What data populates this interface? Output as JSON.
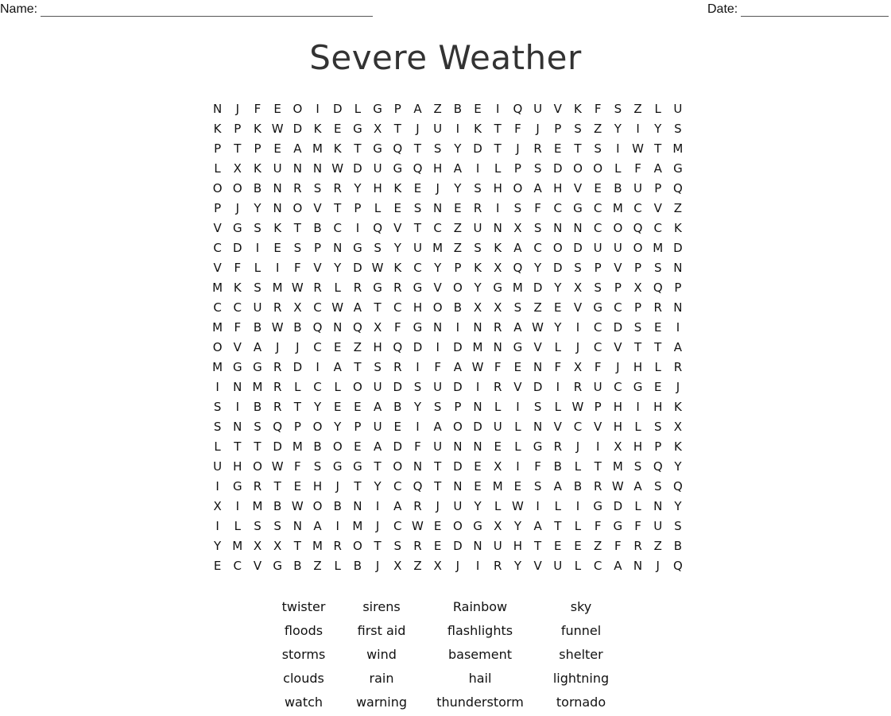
{
  "header": {
    "name_label": "Name:",
    "date_label": "Date:"
  },
  "title": "Severe Weather",
  "grid": [
    "NJFEOIDLGPAZBEIQUVKFSZLU",
    "KPKWDKEGXTJUIKTFJPSZYIYS",
    "PTPEAMKTGQTSYDTJRETSIWTM",
    "LXKUNNWDUGQHAILPSDOOLFAG",
    "OOBNRSRYHKEJYSHOAHVEBUPQ",
    "PJYNOVTPLESNERISFCGCMCVZ",
    "VGSKTBCIQVTCZUNXSNNCOQCK",
    "CDIESPNGSYUMZSKACODUUOMD",
    "VFLIFVYDWKCYPKXQYDSPVPSN",
    "MKSMWRLRGRGVOYGMDYXSPXQP",
    "CCURXCWATCHOBXXSZEVGCPRN",
    "MFBWBQNQXFGNINRAWYICDSEI",
    "OVAJJCEZHQDIDMNGVLJCVTTA",
    "MGGRDIATSRIFAWFENFXFJHLR",
    "INMRLCLOUDSUDIRVDIRUCGEJ",
    "SIBRTYEEABYSPNLISLWPHIHK",
    "SNSQPOYPUEIAODULNVCVHLSX",
    "LTTDMBOEADFUNNELGRJIXHPK",
    "UHOWFSGGTONTDEXIFBLTMSQY",
    "IGRTEHJTYCQTNEMESABRWASQ",
    "XIMBWOBNIARJUYLWILIGDLNY",
    "ILSSNAIMJCWEOGXYATLFGFUS",
    "YMXXTMROTSREDNUHTEEZFRZB",
    "ECVGBZLBJXZXJIRYVULCANJQ"
  ],
  "word_list": [
    [
      "twister",
      "sirens",
      "Rainbow",
      "sky"
    ],
    [
      "floods",
      "first aid",
      "flashlights",
      "funnel"
    ],
    [
      "storms",
      "wind",
      "basement",
      "shelter"
    ],
    [
      "clouds",
      "rain",
      "hail",
      "lightning"
    ],
    [
      "watch",
      "warning",
      "thunderstorm",
      "tornado"
    ]
  ]
}
